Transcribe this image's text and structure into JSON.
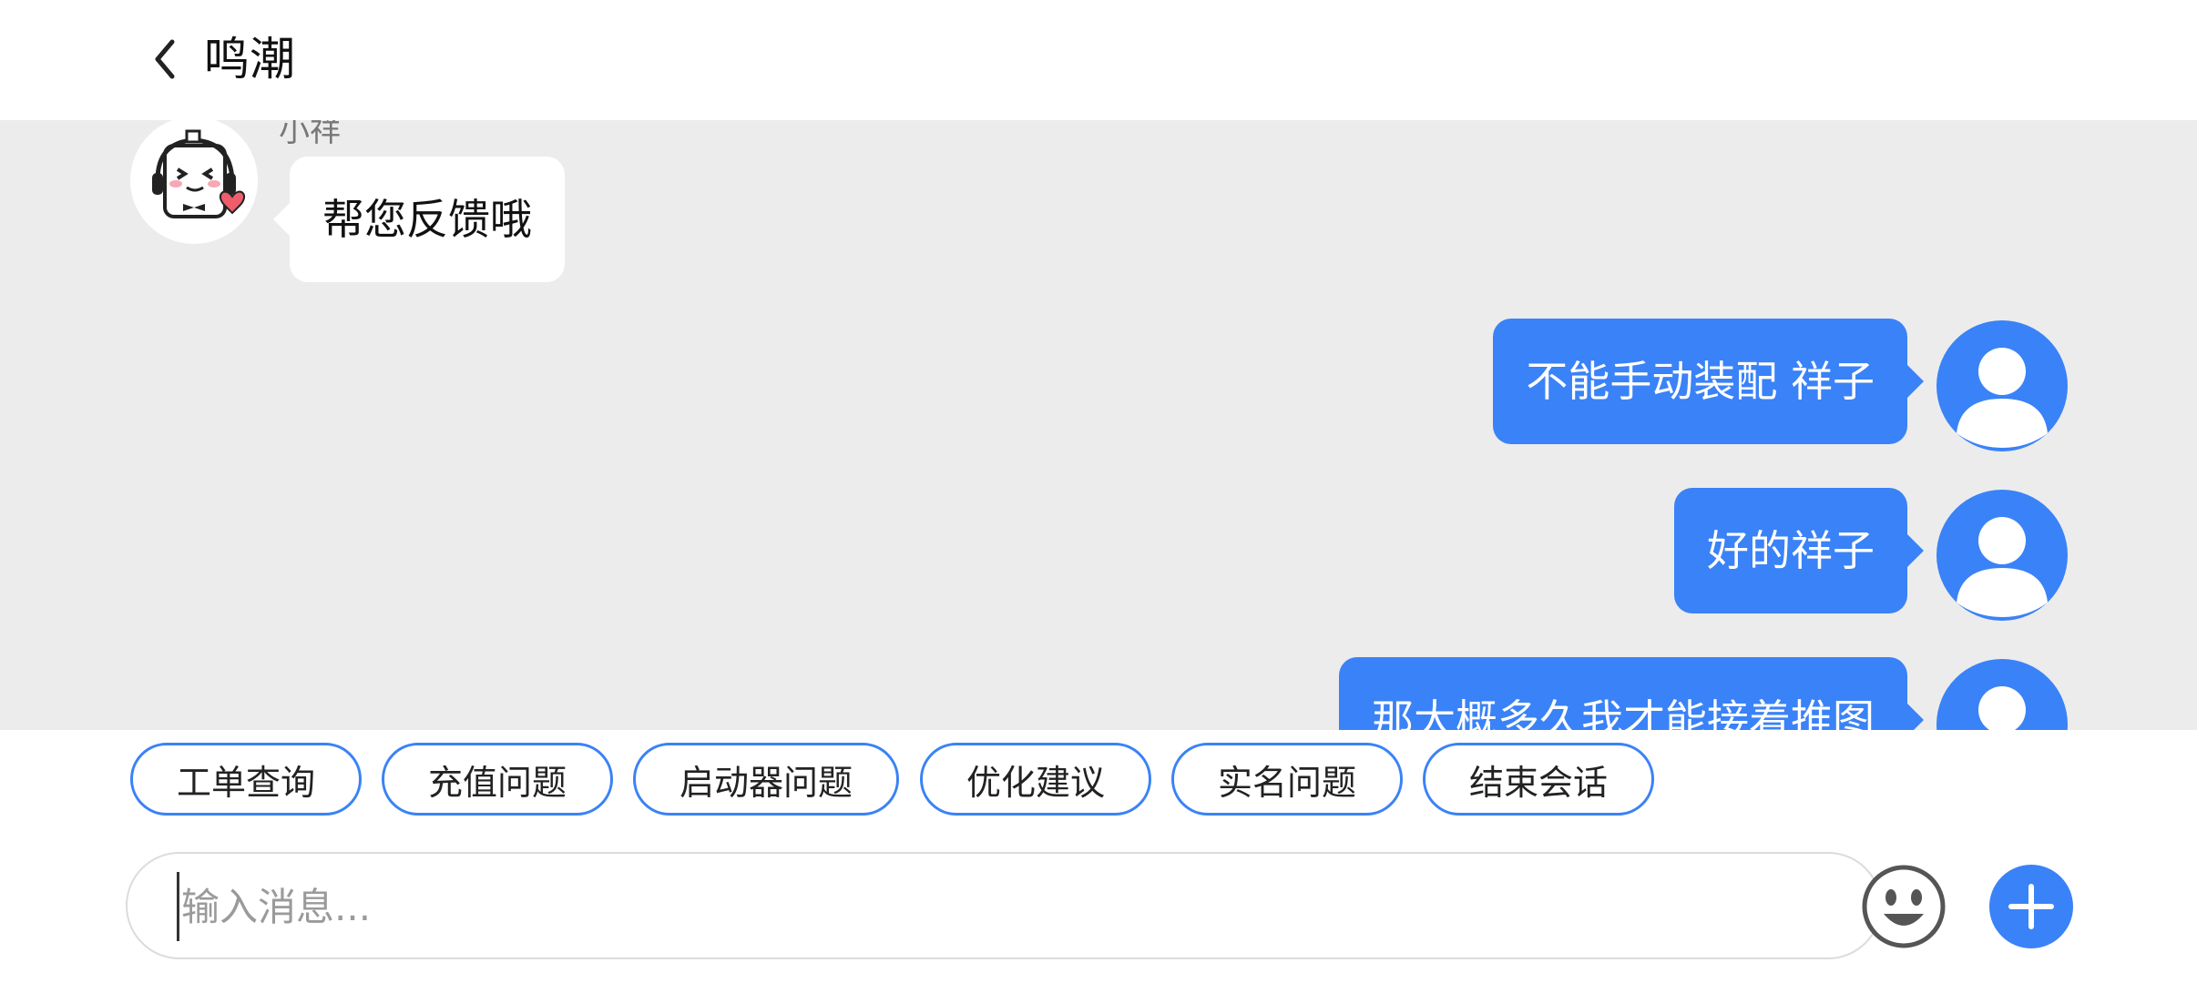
{
  "header": {
    "title": "鸣潮"
  },
  "icons": {
    "back": "chevron-left-icon",
    "agent_avatar": "robot-mascot-avatar",
    "user_avatar": "user-silhouette-icon",
    "emoji": "smiley-face-icon",
    "add": "plus-icon"
  },
  "chat": {
    "agent_name": "小祥",
    "messages": [
      {
        "from": "agent",
        "text": "帮您反馈哦"
      },
      {
        "from": "user",
        "text": "不能手动装配 祥子"
      },
      {
        "from": "user",
        "text": "好的祥子"
      },
      {
        "from": "user",
        "text": "那大概多久我才能接着推图"
      }
    ]
  },
  "quick_replies": [
    "工单查询",
    "充值问题",
    "启动器问题",
    "优化建议",
    "实名问题",
    "结束会话"
  ],
  "input": {
    "placeholder": "输入消息...",
    "value": ""
  },
  "colors": {
    "accent": "#3a82f7",
    "chat_background": "#ececec",
    "agent_bubble": "#ffffff"
  }
}
